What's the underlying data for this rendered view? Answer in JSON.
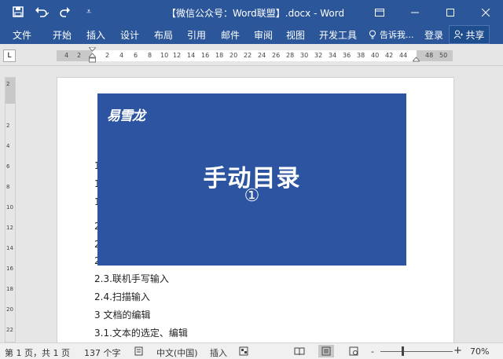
{
  "window": {
    "title": "【微信公众号：Word联盟】.docx - Word"
  },
  "qat": {
    "more_label": "⩡"
  },
  "ribbon": {
    "tabs": [
      "文件",
      "开始",
      "插入",
      "设计",
      "布局",
      "引用",
      "邮件",
      "审阅",
      "视图",
      "开发工具"
    ],
    "tell_me": "告诉我...",
    "login": "登录",
    "share": "共享"
  },
  "ruler": {
    "tab_selector": "L",
    "h_ticks": [
      "4",
      "2",
      "2",
      "4",
      "6",
      "8",
      "10",
      "12",
      "14",
      "16",
      "18",
      "20",
      "22",
      "24",
      "26",
      "28",
      "30",
      "32",
      "34",
      "36",
      "38",
      "40",
      "42",
      "44",
      "48",
      "50"
    ],
    "v_ticks": [
      "2",
      "2",
      "4",
      "6",
      "8",
      "10",
      "12",
      "14",
      "16",
      "18",
      "20",
      "22"
    ]
  },
  "document": {
    "banner": {
      "brand": "易雪龙",
      "title": "手动目录",
      "number": "①"
    },
    "lines": [
      "2.3.联机手写输入",
      "2.4.扫描输入",
      "3  文档的编辑",
      "3.1.文本的选定、编辑"
    ],
    "behind_chars": [
      "1",
      "1",
      "1",
      "2",
      "2",
      "2"
    ]
  },
  "status": {
    "page": "第 1 页，共 1 页",
    "words": "137 个字",
    "language": "中文(中国)",
    "mode": "插入",
    "zoom_minus": "-",
    "zoom_plus": "+",
    "zoom": "70%"
  },
  "colors": {
    "titlebar": "#2b579a",
    "banner": "#2c54a0"
  }
}
